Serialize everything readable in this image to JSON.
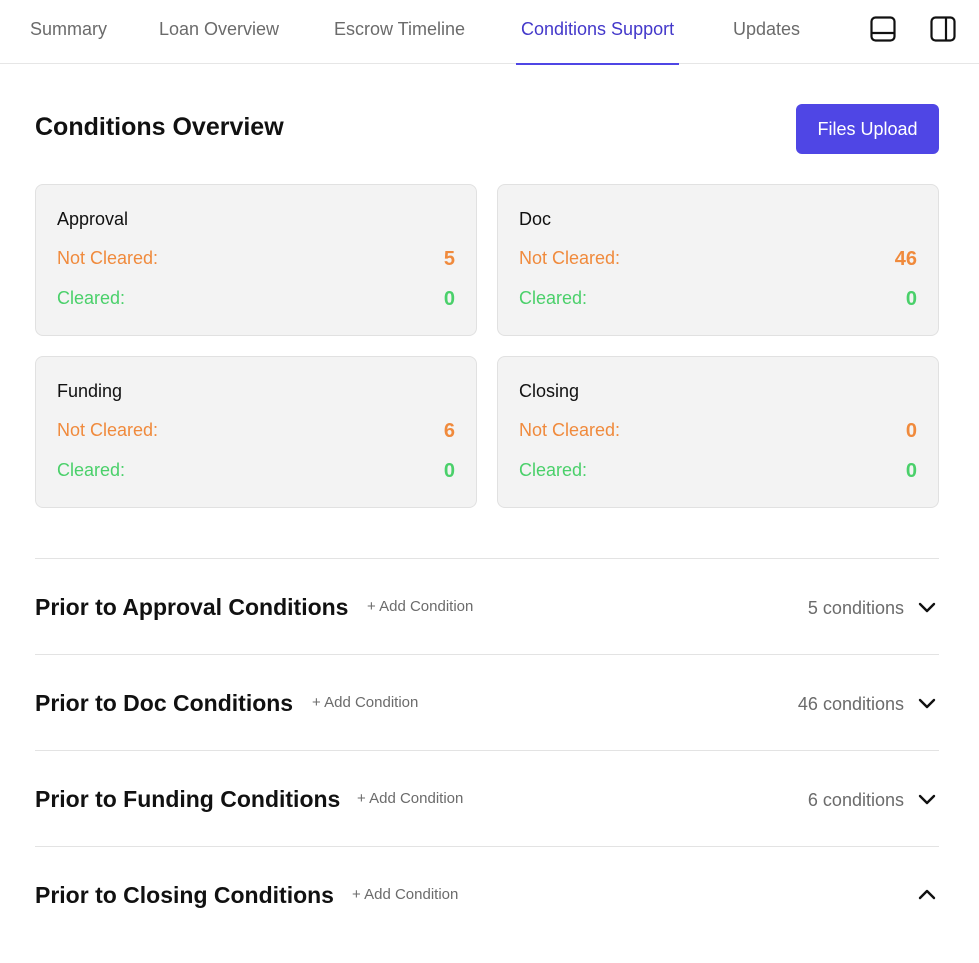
{
  "tabs": {
    "summary": "Summary",
    "loan_overview": "Loan Overview",
    "escrow_timeline": "Escrow Timeline",
    "conditions_support": "Conditions Support",
    "updates": "Updates",
    "active": "Conditions Support"
  },
  "header": {
    "title": "Conditions Overview",
    "upload_label": "Files Upload"
  },
  "cards": [
    {
      "title": "Approval",
      "not_cleared_label": "Not Cleared:",
      "not_cleared": "5",
      "cleared_label": "Cleared:",
      "cleared": "0"
    },
    {
      "title": "Doc",
      "not_cleared_label": "Not Cleared:",
      "not_cleared": "46",
      "cleared_label": "Cleared:",
      "cleared": "0"
    },
    {
      "title": "Funding",
      "not_cleared_label": "Not Cleared:",
      "not_cleared": "6",
      "cleared_label": "Cleared:",
      "cleared": "0"
    },
    {
      "title": "Closing",
      "not_cleared_label": "Not Cleared:",
      "not_cleared": "0",
      "cleared_label": "Cleared:",
      "cleared": "0"
    }
  ],
  "sections": [
    {
      "title": "Prior to Approval Conditions",
      "add_label": "+ Add Condition",
      "count": "5 conditions",
      "expanded": false
    },
    {
      "title": "Prior to Doc Conditions",
      "add_label": "+ Add Condition",
      "count": "46 conditions",
      "expanded": false
    },
    {
      "title": "Prior to Funding Conditions",
      "add_label": "+ Add Condition",
      "count": "6 conditions",
      "expanded": false
    },
    {
      "title": "Prior to Closing Conditions",
      "add_label": "+ Add Condition",
      "count": "",
      "expanded": true
    }
  ],
  "icons": {
    "layout_bottom": "panel-bottom-icon",
    "layout_side": "panel-right-icon",
    "collapsed": "chevron-down-icon",
    "expanded": "chevron-up-icon"
  },
  "colors": {
    "accent": "#4f46e5",
    "not_cleared": "#f08a3c",
    "cleared": "#4ad06a"
  }
}
